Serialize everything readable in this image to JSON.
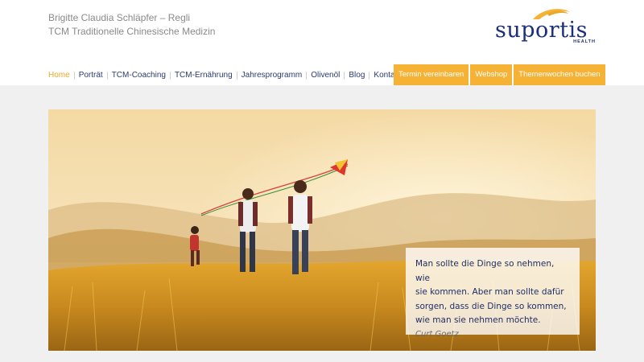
{
  "brand": {
    "name": "Brigitte Claudia Schläpfer – Regli",
    "subtitle": "TCM Traditionelle Chinesische Medizin",
    "logo_text": "suportis",
    "logo_tagline": "HEALTH"
  },
  "nav": {
    "items": [
      {
        "label": "Home",
        "active": true
      },
      {
        "label": "Porträt",
        "active": false
      },
      {
        "label": "TCM-Coaching",
        "active": false
      },
      {
        "label": "TCM-Ernährung",
        "active": false
      },
      {
        "label": "Jahresprogramm",
        "active": false
      },
      {
        "label": "Olivenöl",
        "active": false
      },
      {
        "label": "Blog",
        "active": false
      },
      {
        "label": "Kontakt",
        "active": false
      }
    ]
  },
  "cta": {
    "appointment": "Termin vereinbaren",
    "webshop": "Webshop",
    "theme_weeks": "Themenwochen buchen"
  },
  "hero": {
    "image": "family-running-with-kite-in-golden-field",
    "quote_lines": [
      "Man sollte die Dinge so nehmen, wie",
      "sie kommen. Aber man sollte dafür",
      "sorgen, dass die Dinge so kommen,",
      "wie man sie nehmen möchte."
    ],
    "quote_author": "Curt Goetz"
  },
  "colors": {
    "accent": "#f5b235",
    "nav_text": "#2a3b6e",
    "active_nav": "#e9a825",
    "brand_blue": "#1b2f7a"
  }
}
